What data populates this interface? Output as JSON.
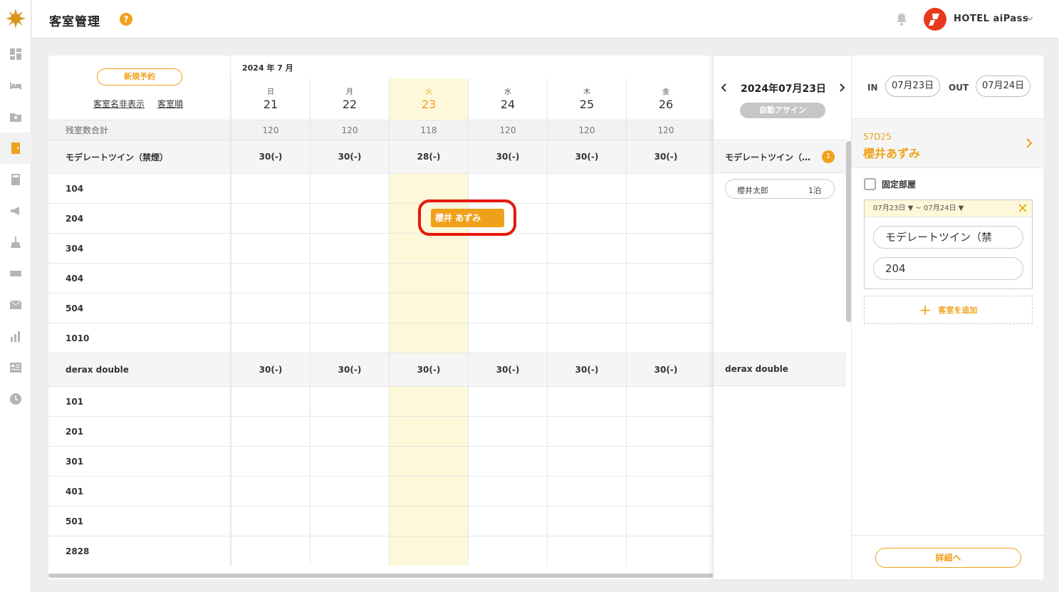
{
  "colors": {
    "accent": "#f0a11c",
    "today_bg": "#fdf8d9",
    "highlight_ring": "#e8180a"
  },
  "header": {
    "title": "客室管理",
    "help_icon": "?",
    "hotel_name": "HOTEL aiPass"
  },
  "sidebar": {
    "icons": [
      "logo-sun-icon",
      "dashboard-icon",
      "bed-icon",
      "folder-person-icon",
      "door-icon",
      "calculator-icon",
      "megaphone-icon",
      "cleaning-icon",
      "ticket-icon",
      "mail-icon",
      "bar-chart-icon",
      "list-icon",
      "clock-icon"
    ]
  },
  "calendar": {
    "new_reservation": "新規予約",
    "hide_room_names": "客室名非表示",
    "room_order": "客室順",
    "month_label": "2024 年 7 月",
    "days": [
      {
        "dow": "日",
        "day": "21"
      },
      {
        "dow": "月",
        "day": "22"
      },
      {
        "dow": "火",
        "day": "23"
      },
      {
        "dow": "水",
        "day": "24"
      },
      {
        "dow": "木",
        "day": "25"
      },
      {
        "dow": "金",
        "day": "26"
      }
    ],
    "remaining_label": "残室数合計",
    "remaining": [
      "120",
      "120",
      "118",
      "120",
      "120",
      "120"
    ],
    "types": [
      {
        "name": "モデレートツイン（禁煙）",
        "counts": [
          "30(-)",
          "30(-)",
          "28(-)",
          "30(-)",
          "30(-)",
          "30(-)"
        ],
        "rooms": [
          "104",
          "204",
          "304",
          "404",
          "504",
          "1010"
        ]
      },
      {
        "name": "derax double",
        "counts": [
          "30(-)",
          "30(-)",
          "30(-)",
          "30(-)",
          "30(-)",
          "30(-)"
        ],
        "rooms": [
          "101",
          "201",
          "301",
          "401",
          "501",
          "2828"
        ]
      }
    ],
    "booking": {
      "guest": "櫻井 あずみ"
    }
  },
  "middle": {
    "date": "2024年07月23日",
    "auto_assign": "自動アサイン",
    "type1": "モデレートツイン（…",
    "badge": "1",
    "guest": "櫻井太郎",
    "stay": "1泊",
    "type2": "derax double"
  },
  "detail": {
    "in_label": "IN",
    "in_date": "07月23日",
    "out_label": "OUT",
    "out_date": "07月24日",
    "code": "57D25",
    "name": "櫻井あずみ",
    "fixed_room": "固定部屋",
    "range": "07月23日 ▼ ~ 07月24日 ▼",
    "room_type": "モデレートツイン（禁",
    "room_number": "204",
    "add_room": "客室を追加",
    "details_button": "詳細へ"
  }
}
